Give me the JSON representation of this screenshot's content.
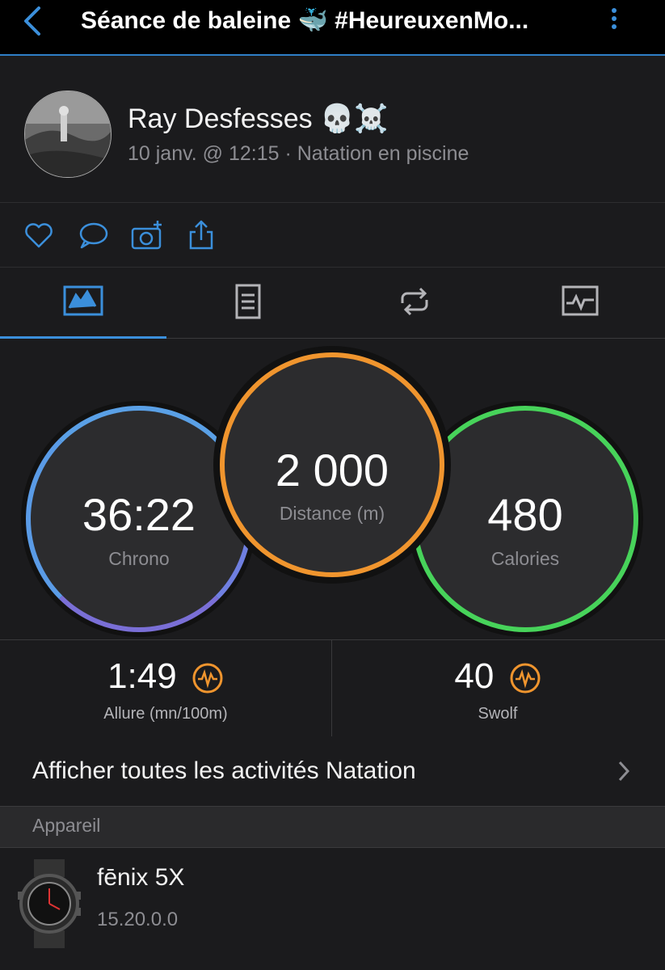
{
  "header": {
    "title": "Séance de baleine 🐳 #HeureuxenMo...",
    "back_icon": "chevron-left-icon",
    "menu_icon": "more-vertical-icon"
  },
  "profile": {
    "name": "Ray Desfesses 💀☠️",
    "meta": "10 janv. @ 12:15 · Natation en piscine"
  },
  "actions": [
    "heart-icon",
    "comment-icon",
    "add-photo-icon",
    "share-icon"
  ],
  "tabs": [
    "stats-tab-icon",
    "details-tab-icon",
    "laps-tab-icon",
    "chart-tab-icon"
  ],
  "metrics": {
    "chrono": {
      "value": "36:22",
      "label": "Chrono"
    },
    "distance": {
      "value": "2 000",
      "label": "Distance (m)"
    },
    "calories": {
      "value": "480",
      "label": "Calories"
    }
  },
  "stats": {
    "pace": {
      "value": "1:49",
      "label": "Allure (mn/100m)"
    },
    "swolf": {
      "value": "40",
      "label": "Swolf"
    }
  },
  "show_all": "Afficher toutes les activités Natation",
  "section_device": "Appareil",
  "device": {
    "name": "fēnix 5X",
    "version": "15.20.0.0"
  },
  "colors": {
    "accent": "#3b8fdb",
    "chrono_ring": "#5aa0e6",
    "distance_ring": "#f0952e",
    "calories_ring": "#47d35a",
    "badge": "#f0952e"
  }
}
